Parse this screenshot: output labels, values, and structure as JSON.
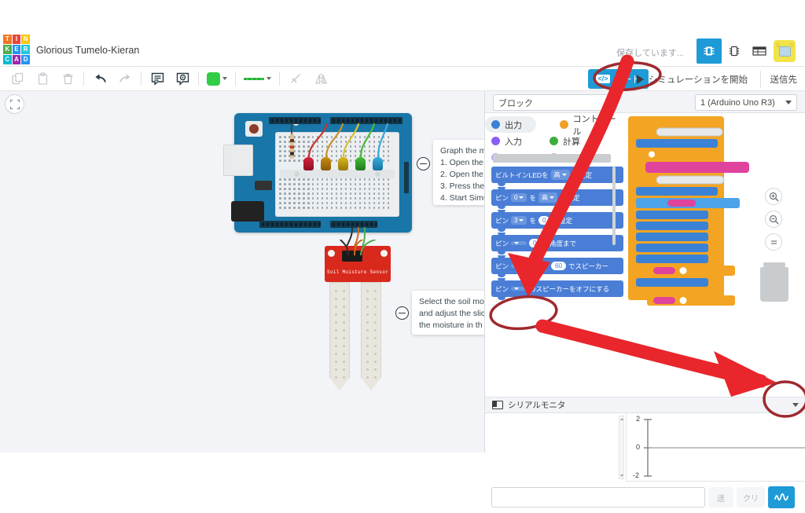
{
  "app": {
    "logo_letters": [
      "T",
      "I",
      "N",
      "K",
      "E",
      "R",
      "C",
      "A",
      "D"
    ],
    "doc_title": "Glorious Tumelo-Kieran",
    "saving_status": "保存しています..."
  },
  "topbar": {
    "icons": [
      {
        "name": "components-panel-icon",
        "active": true
      },
      {
        "name": "circuit-chip-icon",
        "active": false
      },
      {
        "name": "bom-list-icon",
        "active": false
      },
      {
        "name": "user-avatar",
        "active": false
      }
    ]
  },
  "toolbar": {
    "items": [
      {
        "name": "copy-button",
        "label": "Copy"
      },
      {
        "name": "paste-button",
        "label": "Paste"
      },
      {
        "name": "delete-button",
        "label": "Delete"
      },
      {
        "name": "undo-button",
        "label": "Undo"
      },
      {
        "name": "redo-button",
        "label": "Redo"
      },
      {
        "name": "note-button",
        "label": "Note"
      },
      {
        "name": "comment-button",
        "label": "Comment"
      },
      {
        "name": "rotate-button",
        "label": "Rotate"
      },
      {
        "name": "mirror-button",
        "label": "Mirror"
      }
    ],
    "color_swatch": "#32cd46",
    "line_color": "#32cd46",
    "code_label": "コード",
    "code_glyph": "</>",
    "simulate_label": "シミュレーションを開始",
    "send_label": "送信先",
    "fit_view_label": "Fit view"
  },
  "canvas": {
    "background": "#f2f4f7",
    "board_label": "Arduino Uno R3",
    "sensor_label": "Soil Moisture Sensor",
    "leds": [
      "#b3142b",
      "#b07a12",
      "#c9a515",
      "#3aa832",
      "#2e9ed6"
    ],
    "callouts": [
      {
        "name": "graph-instructions-callout",
        "text": "Graph the m\n1. Open the\n2. Open the\n3. Press the\n4. Start Simu"
      },
      {
        "name": "sensor-instructions-callout",
        "text": "Select the soil mo\nand adjust the slic\nthe moisture in th"
      }
    ]
  },
  "code_panel": {
    "mode_select": "ブロック",
    "board_select": "1 (Arduino Uno R3)",
    "categories": [
      {
        "label": "出力",
        "color": "#3b82d6",
        "selected": true
      },
      {
        "label": "入力",
        "color": "#8b5cf6",
        "selected": false
      },
      {
        "label": "コントロール",
        "color": "#f0a028",
        "selected": false
      },
      {
        "label": "計算",
        "color": "#3dae3d",
        "selected": false
      }
    ],
    "blocks": [
      {
        "pre": "ビルトインLEDを",
        "dropdown": "高",
        "post": "に設定"
      },
      {
        "pre": "ピン",
        "dropdown": "0",
        "mid": "を",
        "dropdown2": "高",
        "post": "に設定"
      },
      {
        "pre": "ピン",
        "dropdown": "3",
        "mid": "を",
        "num": "0",
        "post": "に設定"
      },
      {
        "pre": "ピン",
        "dropdown": "",
        "mid": "",
        "num": "0",
        "post": "の角度まで"
      },
      {
        "pre": "ピン",
        "dropdown": "",
        "mid": "トーン",
        "num": "60",
        "post": "でスピーカー"
      },
      {
        "pre": "ピン",
        "dropdown": "",
        "mid": "のスピーカーをオフにする",
        "post": ""
      }
    ],
    "zoom_in_label": "Zoom in",
    "zoom_out_label": "Zoom out",
    "fit_label": "Fit",
    "trash_label": "Delete blocks"
  },
  "serial_monitor": {
    "title": "シリアルモニタ",
    "input_value": "",
    "send_label": "送",
    "clear_label": "クリ",
    "graph_toggle_label": "Graph"
  },
  "chart_data": {
    "type": "line",
    "title": "",
    "xlabel": "",
    "ylabel": "",
    "y_ticks": [
      "2",
      "0",
      "-2"
    ],
    "ylim": [
      -2,
      2
    ],
    "series": [
      {
        "name": "serial",
        "values": []
      }
    ],
    "grid": false,
    "legend": "none"
  },
  "annotations": {
    "color": "#e8262b",
    "shapes": [
      {
        "name": "code-button-circle",
        "kind": "ellipse"
      },
      {
        "name": "arrow-to-blocks",
        "kind": "arrow"
      },
      {
        "name": "serial-monitor-circle",
        "kind": "ellipse"
      },
      {
        "name": "arrow-to-graph-toggle",
        "kind": "arrow"
      },
      {
        "name": "graph-toggle-circle",
        "kind": "ellipse"
      }
    ]
  }
}
